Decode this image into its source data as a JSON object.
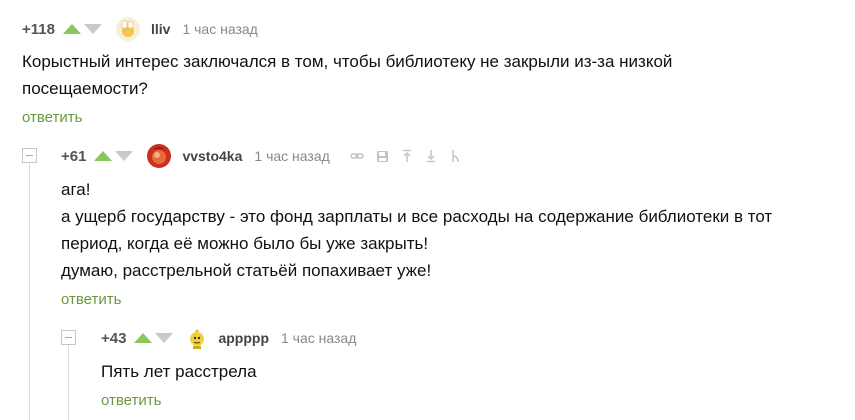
{
  "comments": [
    {
      "rating": "+118",
      "author": "lliv",
      "time": "1 час назад",
      "text": [
        "Корыстный интерес заключался в том, чтобы библиотеку не закрыли из-за низкой",
        "посещаемости?"
      ],
      "reply_label": "ответить"
    },
    {
      "rating": "+61",
      "author": "vvsto4ka",
      "time": "1 час назад",
      "text": [
        "ага!",
        "а ущерб государству - это фонд зарплаты и все расходы на содержание библиотеки в тот",
        "период, когда её можно было бы уже закрыть!",
        "думаю, расстрельной статьёй попахивает уже!"
      ],
      "reply_label": "ответить"
    },
    {
      "rating": "+43",
      "author": "appppp",
      "time": "1 час назад",
      "text": [
        "Пять лет расстрела"
      ],
      "reply_label": "ответить"
    }
  ],
  "colors": {
    "upvote": "#8ac858",
    "downvote": "#c9c9c9",
    "reply_link": "#6a9a3f",
    "muted": "#888888"
  },
  "icons": [
    "link-icon",
    "save-icon",
    "arrow-up-icon",
    "arrow-down-icon",
    "branch-icon"
  ]
}
